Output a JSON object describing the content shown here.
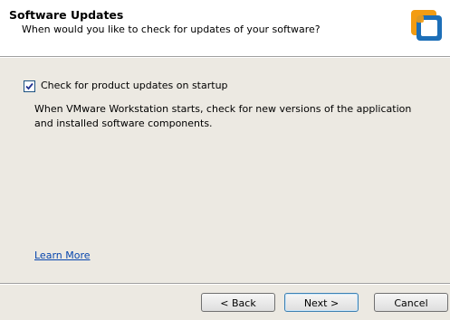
{
  "header": {
    "title": "Software Updates",
    "subtitle": "When would you like to check for updates of your software?",
    "logo_icon": "vmware-workstation-logo-icon"
  },
  "main": {
    "checkbox_checked": true,
    "checkbox_label": "Check for product updates on startup",
    "description": "When VMware Workstation starts, check for new versions of the application and installed software components.",
    "learn_more": "Learn More"
  },
  "footer": {
    "back_label": "< Back",
    "next_label": "Next >",
    "cancel_label": "Cancel"
  },
  "colors": {
    "background": "#ece9e2",
    "link": "#0645ad"
  }
}
